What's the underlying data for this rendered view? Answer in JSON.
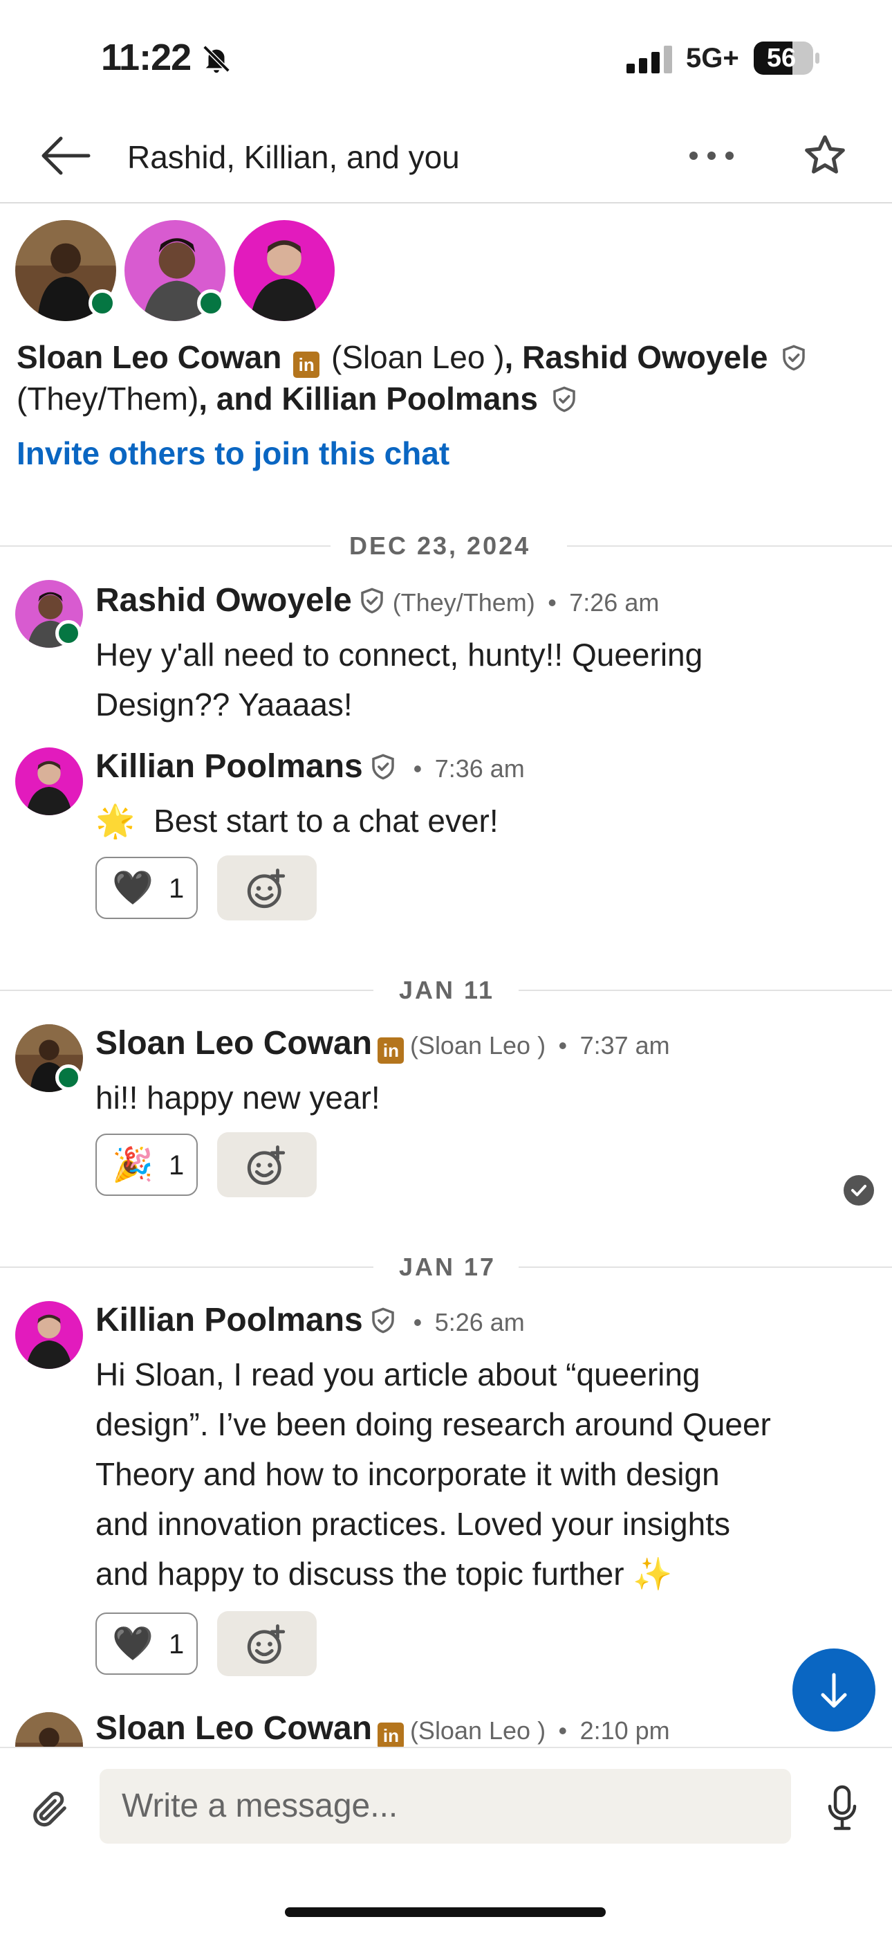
{
  "status_bar": {
    "time": "11:22",
    "network": "5G+",
    "battery": "56"
  },
  "header": {
    "title": "Rashid, Killian, and you"
  },
  "participants": {
    "p1_name": "Sloan Leo Cowan",
    "p1_alias": "(Sloan Leo )",
    "p2_name": ", Rashid Owoyele",
    "p2_pronouns": "(They/Them)",
    "p3_name": ", and Killian Poolmans"
  },
  "invite_link": "Invite others to join this chat",
  "linkedin_badge": "in",
  "conversation": [
    {
      "date": "DEC 23, 2024"
    },
    {
      "sender": "Rashid Owoyele",
      "pronouns": "(They/Them)",
      "time": "7:26 am",
      "lines": [
        "Hey y'all need to connect, hunty!! Queering",
        "Design?? Yaaaas!"
      ]
    },
    {
      "sender": "Killian Poolmans",
      "time": "7:36 am",
      "emoji": "🌟",
      "text": "Best start to a chat ever!",
      "reaction": {
        "emoji": "🖤",
        "count": "1"
      }
    },
    {
      "date": "JAN 11"
    },
    {
      "sender": "Sloan Leo Cowan",
      "alias": "(Sloan Leo )",
      "time": "7:37 am",
      "text": "hi!! happy new year!",
      "reaction": {
        "emoji": "🎉",
        "count": "1"
      }
    },
    {
      "date": "JAN 17"
    },
    {
      "sender": "Killian Poolmans",
      "time": "5:26 am",
      "lines": [
        "Hi Sloan, I read you article about “queering",
        "design”. I’ve been doing research around Queer",
        "Theory and how to incorporate it with design",
        "and innovation practices. Loved your insights",
        "and happy to discuss the topic further"
      ],
      "trailing_emoji": "✨",
      "reaction": {
        "emoji": "🖤",
        "count": "1"
      }
    },
    {
      "sender": "Sloan Leo Cowan",
      "alias": "(Sloan Leo )",
      "time": "2:10 pm"
    }
  ],
  "separator_dot": "•",
  "composer": {
    "placeholder": "Write a message..."
  },
  "colors": {
    "accent": "#0a66c2",
    "online": "#057642",
    "linkedin": "#b4751d",
    "avatar_pink": "#e21bbd"
  }
}
